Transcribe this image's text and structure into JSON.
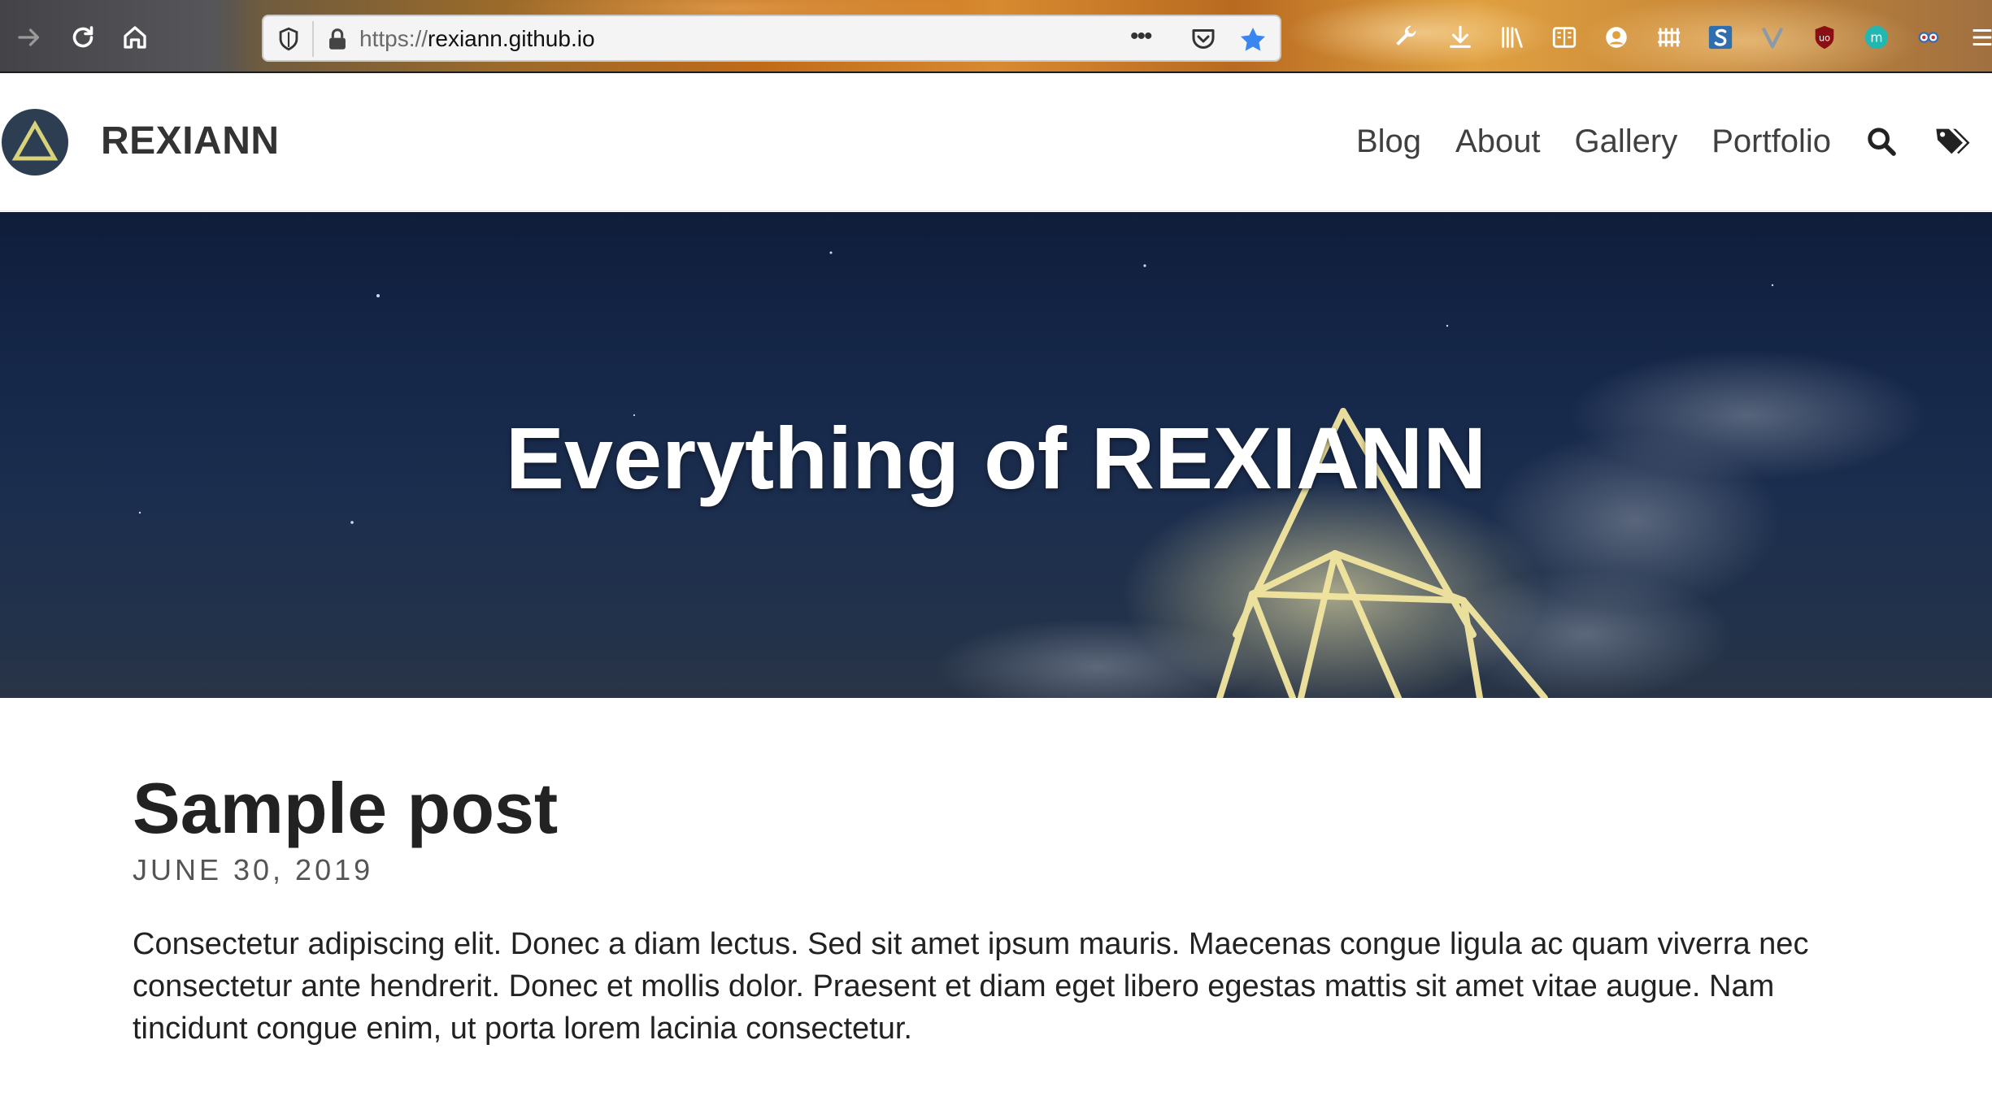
{
  "browser": {
    "url_scheme": "https://",
    "url_host": "rexiann.github.io",
    "more_label": "•••",
    "extensions": [
      "wrench-icon",
      "download-icon",
      "library-icon",
      "reader-view-icon",
      "account-icon",
      "grid-extension-icon",
      "s-extension-icon",
      "v-extension-icon",
      "ublock-icon",
      "m-extension-icon",
      "owl-extension-icon"
    ]
  },
  "site": {
    "brand": "REXIANN",
    "nav": {
      "blog": "Blog",
      "about": "About",
      "gallery": "Gallery",
      "portfolio": "Portfolio"
    }
  },
  "hero": {
    "title": "Everything of REXIANN"
  },
  "post": {
    "title": "Sample post",
    "date": "JUNE 30, 2019",
    "excerpt": "Consectetur adipiscing elit. Donec a diam lectus. Sed sit amet ipsum mauris. Maecenas congue ligula ac quam viverra nec consectetur ante hendrerit. Donec et mollis dolor. Praesent et diam eget libero egestas mattis sit amet vitae augue. Nam tincidunt congue enim, ut porta lorem lacinia consectetur."
  },
  "colors": {
    "accent_star": "#3a86f0",
    "logo_bg": "#2e3e52",
    "logo_triangle": "#d8d27a",
    "hero_bg": "#16284a"
  }
}
